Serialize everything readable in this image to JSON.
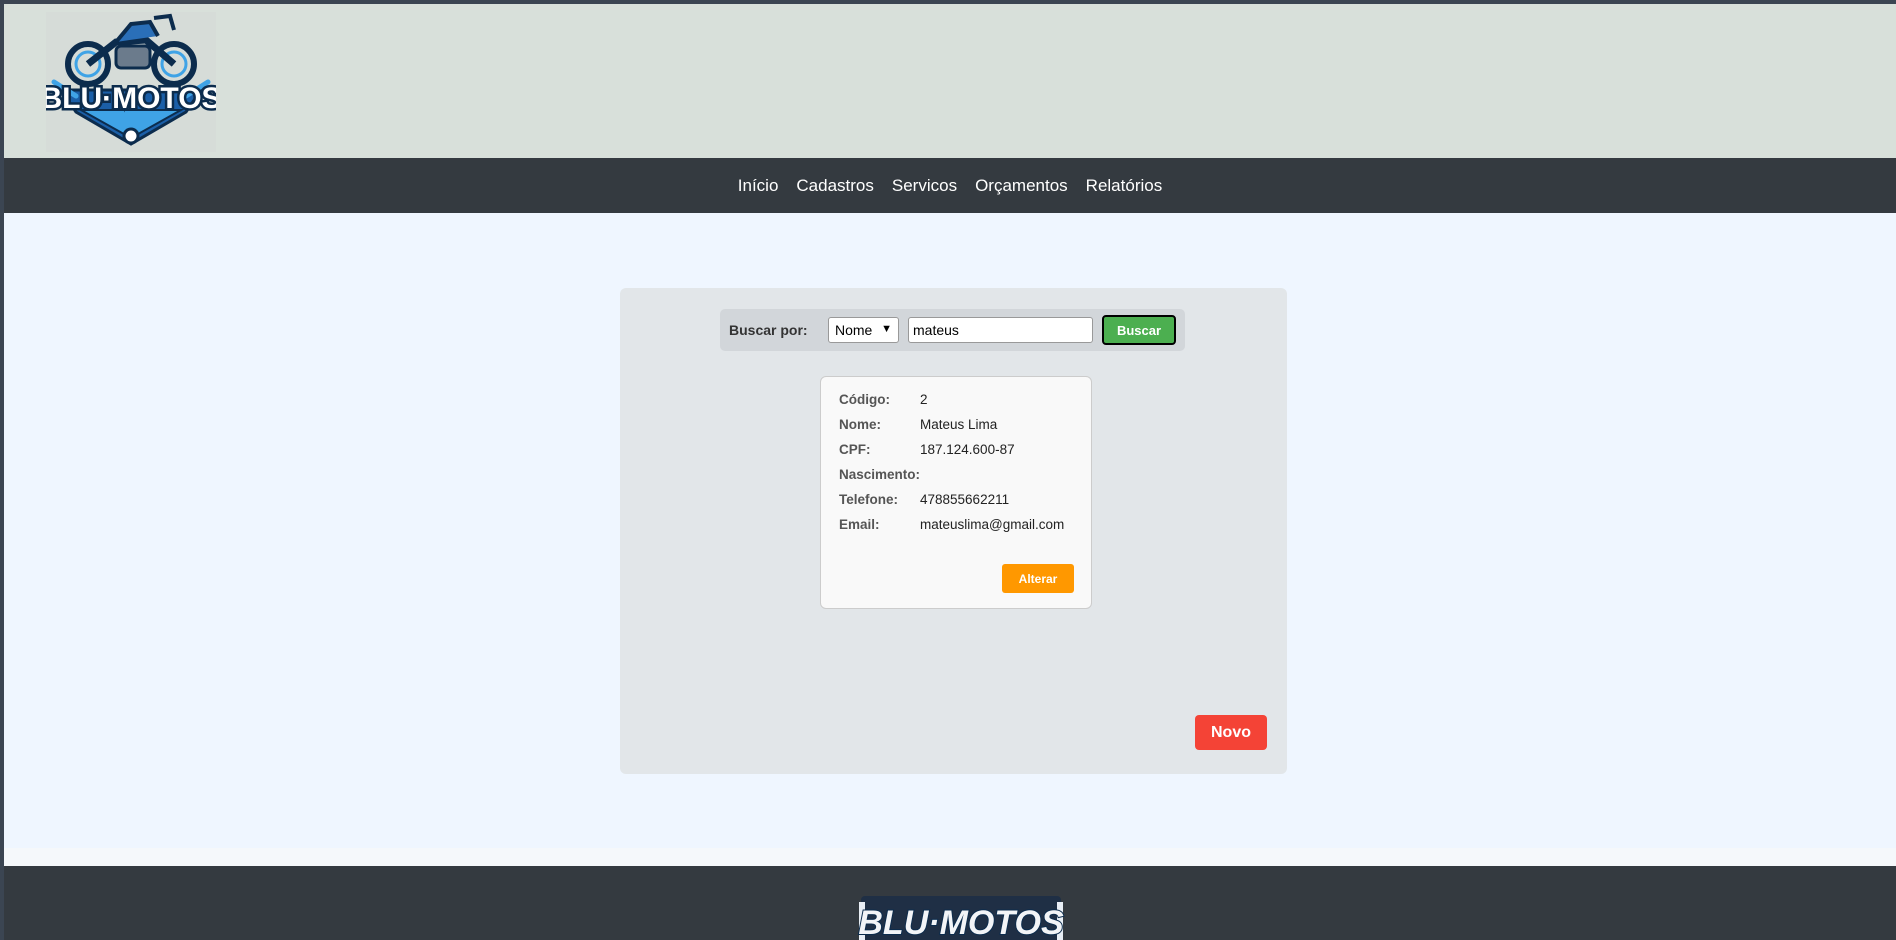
{
  "brand": {
    "logo_text": "BLU·MOTOS"
  },
  "nav": {
    "items": [
      {
        "label": "Início"
      },
      {
        "label": "Cadastros"
      },
      {
        "label": "Servicos"
      },
      {
        "label": "Orçamentos"
      },
      {
        "label": "Relatórios"
      }
    ]
  },
  "search": {
    "label": "Buscar por:",
    "field_selected": "Nome",
    "query_value": "mateus",
    "button_label": "Buscar"
  },
  "record": {
    "fields": [
      {
        "label": "Código:",
        "value": "2"
      },
      {
        "label": "Nome:",
        "value": "Mateus Lima"
      },
      {
        "label": "CPF:",
        "value": "187.124.600-87"
      },
      {
        "label": "Nascimento:",
        "value": ""
      },
      {
        "label": "Telefone:",
        "value": "478855662211"
      },
      {
        "label": "Email:",
        "value": "mateuslima@gmail.com"
      }
    ],
    "edit_label": "Alterar"
  },
  "actions": {
    "new_label": "Novo"
  },
  "footer": {
    "logo_text": "BLU·MOTOS"
  },
  "colors": {
    "nav_bg": "#343a40",
    "search_button": "#4caf50",
    "edit_button": "#ff9800",
    "new_button": "#f44336",
    "logo_blue": "#1e88e5"
  }
}
